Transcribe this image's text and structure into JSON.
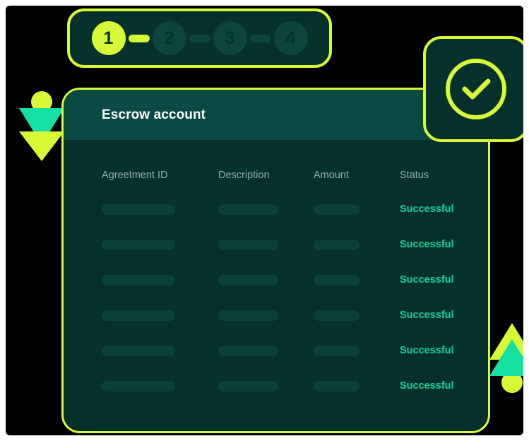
{
  "theme": {
    "page_background": "#ffffff",
    "canvas_background": "#000000",
    "card_background": "#06302c",
    "header_band": "#0a4a44",
    "accent_lime": "#d8f936",
    "accent_teal": "#0ad39a",
    "skeleton": "#0b403a",
    "muted_text": "#93aeaa",
    "title_text": "#ffffff"
  },
  "stepper": {
    "name": "progress-stepper",
    "current_step": 1,
    "total_steps": 4,
    "steps": [
      {
        "label": "1",
        "state": "active"
      },
      {
        "label": "2",
        "state": "idle"
      },
      {
        "label": "3",
        "state": "idle"
      },
      {
        "label": "4",
        "state": "idle"
      }
    ],
    "connectors": [
      {
        "state": "done"
      },
      {
        "state": "todo"
      },
      {
        "state": "todo"
      }
    ]
  },
  "card": {
    "title": "Escrow account"
  },
  "table": {
    "columns": [
      {
        "key": "agreement_id",
        "label": "Agreetment ID"
      },
      {
        "key": "description",
        "label": "Description"
      },
      {
        "key": "amount",
        "label": "Amount"
      },
      {
        "key": "status",
        "label": "Status"
      }
    ],
    "rows": [
      {
        "agreement_id": "",
        "description": "",
        "amount": "",
        "status": "Successful"
      },
      {
        "agreement_id": "",
        "description": "",
        "amount": "",
        "status": "Successful"
      },
      {
        "agreement_id": "",
        "description": "",
        "amount": "",
        "status": "Successful"
      },
      {
        "agreement_id": "",
        "description": "",
        "amount": "",
        "status": "Successful"
      },
      {
        "agreement_id": "",
        "description": "",
        "amount": "",
        "status": "Successful"
      },
      {
        "agreement_id": "",
        "description": "",
        "amount": "",
        "status": "Successful"
      }
    ]
  },
  "badge": {
    "name": "success-check-badge",
    "icon": "circle-check-icon"
  },
  "decorations": {
    "left": {
      "icon": "double-down-arrow-icon"
    },
    "right": {
      "icon": "double-up-arrow-icon"
    }
  }
}
